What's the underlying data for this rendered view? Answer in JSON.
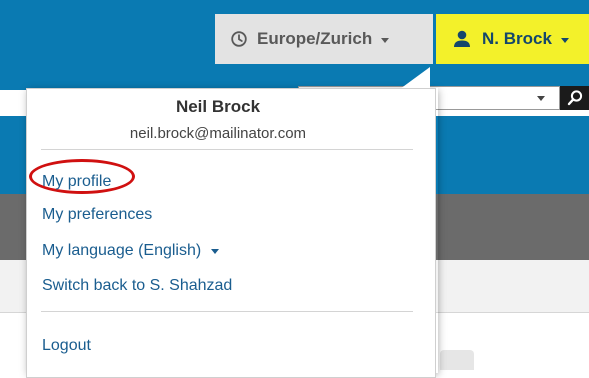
{
  "header": {
    "timezone_label": "Europe/Zurich",
    "user_button_label": "N. Brock"
  },
  "user_menu": {
    "name": "Neil Brock",
    "email": "neil.brock@mailinator.com",
    "items": [
      {
        "label": "My profile"
      },
      {
        "label": "My preferences"
      },
      {
        "label": "My language (English)"
      },
      {
        "label": "Switch back to S. Shahzad"
      }
    ],
    "logout_label": "Logout"
  },
  "colors": {
    "topbar": "#0a7ab2",
    "user_button": "#f3f12a",
    "link": "#1a5d8f",
    "highlight": "#d01010"
  }
}
